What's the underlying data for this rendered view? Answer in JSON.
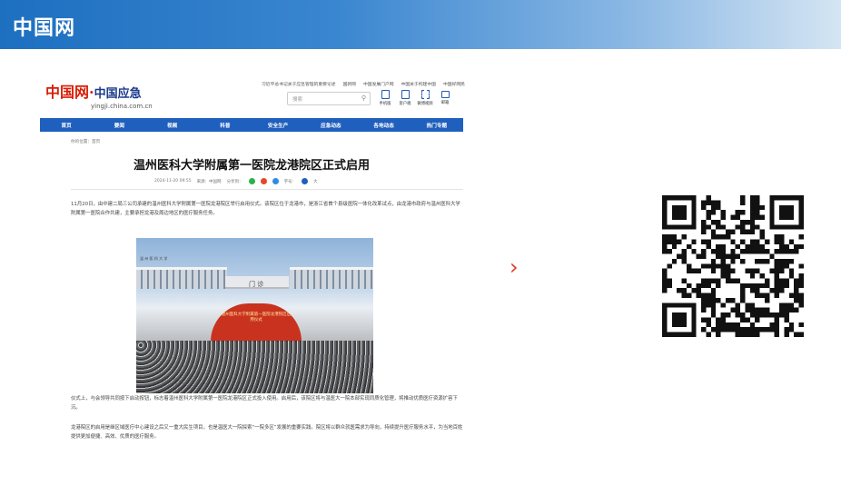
{
  "banner": {
    "title": "中国网"
  },
  "site": {
    "logo_text": "中国网·",
    "logo_sub": "中国应急",
    "logo_url": "yingji.china.com.cn",
    "top_links": [
      "习近平总书记关于应急管理的重要论述",
      "国新网",
      "中国发展门户网",
      "中国关于构建中国",
      "中国好网民"
    ],
    "search_placeholder": "搜索",
    "tools": [
      "手机版",
      "客户端",
      "微博视频",
      "邮箱"
    ]
  },
  "nav": {
    "items": [
      "首页",
      "要闻",
      "视频",
      "科普",
      "安全生产",
      "应急动态",
      "各地动态",
      "热门专题"
    ]
  },
  "article": {
    "breadcrumb": "你的位置：首页",
    "title": "温州医科大学附属第一医院龙港院区正式启用",
    "meta": {
      "date": "2024-11-20 09:55",
      "source": "来源：中国网",
      "editor": "分享到：",
      "font_label": "字号：",
      "size": "大"
    },
    "paragraph1": "11月20日，由中建二局三公司承建的温州医科大学附属第一医院龙港院区举行启用仪式。该院区位于龙港市，是浙江省首个县级医院一体化改革试点，由龙港市政府与温州医科大学附属第一医院合作共建，主要承担龙港及周边地区的医疗服务任务。",
    "photo_gate": "门 诊",
    "photo_caption": "温 州 医 科 大 学",
    "photo_banner": "温州医科大学附属第一医院龙港院区启用仪式",
    "paragraph2": "仪式上，与会领导共同按下启动按钮，标志着温州医科大学附属第一医院龙港院区正式投入使用。启用后，该院区将与温医大一院本部实现同质化管理，将推动优质医疗资源扩容下沉。",
    "paragraph3": "龙港院区的启用是继区域医疗中心建设之后又一重大民生项目，也是温医大一院探索“一院多区”发展的重要实践。院区将以群众就医需求为导向，持续提升医疗服务水平，为当地百姓提供更加便捷、高效、优质的医疗服务。"
  },
  "arrow": "›",
  "colors": {
    "banner": "#1d6fc0",
    "nav": "#1f5fbd",
    "logo_red": "#d81e06",
    "arrow": "#e03c2a"
  }
}
